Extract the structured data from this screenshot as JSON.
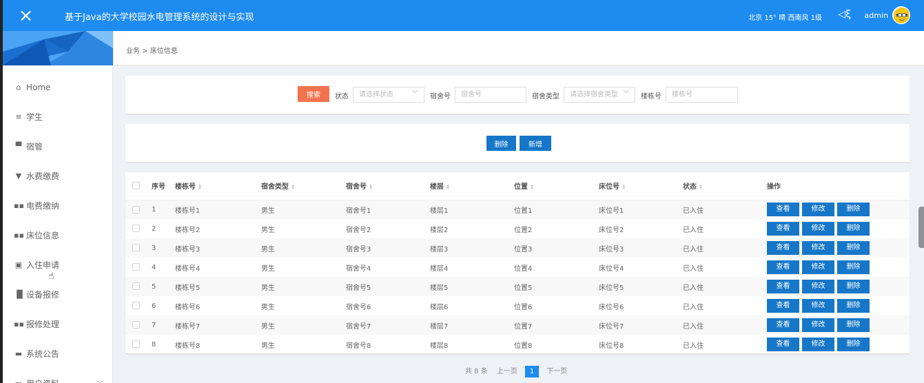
{
  "header": {
    "close_icon": "×",
    "title": "基于Java的大学校园水电管理系统的设计与实现",
    "weather": "北京 15° 晴 西南风 1级",
    "sound_icon": "◁ξ",
    "username": "admin"
  },
  "sidebar": {
    "items": [
      {
        "icon": "⌂",
        "label": "Home"
      },
      {
        "icon": "≡",
        "label": "学生"
      },
      {
        "icon": "▀",
        "label": "宿管"
      },
      {
        "icon": "▼",
        "label": "水费缴费"
      },
      {
        "icon": "▪▪",
        "label": "电费缴纳"
      },
      {
        "icon": "▪▪",
        "label": "床位信息"
      },
      {
        "icon": "▣",
        "label": "入住申请"
      },
      {
        "icon": "▐▌",
        "label": "设备报修"
      },
      {
        "icon": "▪▪",
        "label": "报修处理"
      },
      {
        "icon": "▬",
        "label": "系统公告"
      },
      {
        "icon": "▭",
        "label": "用户资料",
        "chevron": "﹀"
      }
    ]
  },
  "breadcrumb": "业务 > 床位信息",
  "search": {
    "button": "搜索",
    "status_label": "状态",
    "status_placeholder": "请选择状态",
    "room_label": "宿舍号",
    "room_placeholder": "宿舍号",
    "room_type_label": "宿舍类型",
    "room_type_placeholder": "请选择宿舍类型",
    "building_label": "楼栋号",
    "building_placeholder": "楼栋号"
  },
  "actions": {
    "delete": "删除",
    "add": "新增"
  },
  "table": {
    "sort_icon": "⇕",
    "columns": [
      "序号",
      "楼栋号",
      "宿舍类型",
      "宿舍号",
      "楼层",
      "位置",
      "床位号",
      "状态",
      "操作"
    ],
    "row_actions": {
      "view": "查看",
      "edit": "修改",
      "delete": "删除"
    },
    "rows": [
      [
        "1",
        "楼栋号1",
        "男生",
        "宿舍号1",
        "楼层1",
        "位置1",
        "床位号1",
        "已入住"
      ],
      [
        "2",
        "楼栋号2",
        "男生",
        "宿舍号2",
        "楼层2",
        "位置2",
        "床位号2",
        "已入住"
      ],
      [
        "3",
        "楼栋号3",
        "男生",
        "宿舍号3",
        "楼层3",
        "位置3",
        "床位号3",
        "已入住"
      ],
      [
        "4",
        "楼栋号4",
        "男生",
        "宿舍号4",
        "楼层4",
        "位置4",
        "床位号4",
        "已入住"
      ],
      [
        "5",
        "楼栋号5",
        "男生",
        "宿舍号5",
        "楼层5",
        "位置5",
        "床位号5",
        "已入住"
      ],
      [
        "6",
        "楼栋号6",
        "男生",
        "宿舍号6",
        "楼层6",
        "位置6",
        "床位号6",
        "已入住"
      ],
      [
        "7",
        "楼栋号7",
        "男生",
        "宿舍号7",
        "楼层7",
        "位置7",
        "床位号7",
        "已入住"
      ],
      [
        "8",
        "楼栋号8",
        "男生",
        "宿舍号8",
        "楼层8",
        "位置8",
        "床位号8",
        "已入住"
      ]
    ]
  },
  "pagination": {
    "total": "共 8 条",
    "prev": "上一页",
    "current": "1",
    "next": "下一页"
  },
  "colors": {
    "topbar": "#1e8bf0",
    "search_button": "#f4734f",
    "action_button": "#1677c8"
  }
}
